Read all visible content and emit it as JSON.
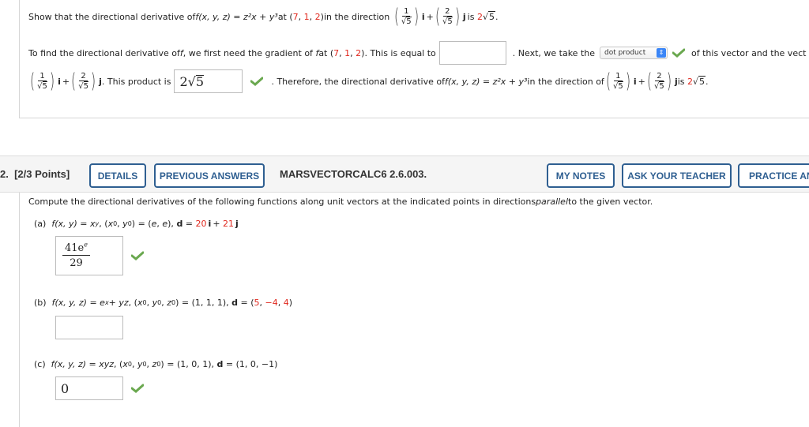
{
  "question1": {
    "statement": {
      "prefix": "Show that the directional derivative of ",
      "function": "f(x, y, z) = z²x + y³",
      "at_text": " at ",
      "point_open": "(",
      "point": [
        "7",
        "1",
        "2"
      ],
      "point_close": ")",
      "direction_text": " in the direction ",
      "direction": {
        "i_num": "1",
        "i_den": "5",
        "j_num": "2",
        "j_den": "5"
      },
      "is_text": " is ",
      "result_coef": "2",
      "result_root": "5"
    },
    "solution": {
      "line1_prefix": "To find the directional derivative of ",
      "f": "f",
      "line1_mid": ", we first need the gradient of ",
      "line1_at": " at ",
      "line1_suffix": ". This is equal to",
      "gradient_input_value": "",
      "next_text": ". Next, we take the",
      "select_value": "dot product",
      "after_select": "of this vector and the vect",
      "line2_product_text": ". This product is",
      "product_answer_coef": "2",
      "product_answer_root": "5",
      "therefore_text": ". Therefore, the directional derivative of ",
      "in_direction_text": " in the direction of ",
      "is_text": " is "
    }
  },
  "question2": {
    "number": "2.",
    "points": "[2/3 Points]",
    "buttons": {
      "details": "DETAILS",
      "previous_answers": "PREVIOUS ANSWERS",
      "my_notes": "MY NOTES",
      "ask_teacher": "ASK YOUR TEACHER",
      "practice": "PRACTICE ANOTHER"
    },
    "code": "MARSVECTORCALC6 2.6.003.",
    "instructions_prefix": "Compute the directional derivatives of the following functions along unit vectors at the indicated points in directions ",
    "instructions_em": "parallel",
    "instructions_suffix": " to the given vector.",
    "parts": [
      {
        "label": "(a)",
        "function": "f(x, y) = x",
        "function_sup": "y",
        "point_text": ", (x",
        "point_vals": "(e, e)",
        "d_label": "d",
        "d_i": "20",
        "d_j": "21",
        "answer_num": "41e",
        "answer_num_sup": "e",
        "answer_den": "29",
        "status": "correct"
      },
      {
        "label": "(b)",
        "function": "f(x, y, z) = e",
        "function_sup": "x",
        "function_rest": " + yz",
        "point_vals": "(1, 1, 1)",
        "d_label": "d",
        "d_vals": [
          "5",
          "−4",
          "4"
        ],
        "answer": "",
        "status": "unanswered"
      },
      {
        "label": "(c)",
        "function": "f(x, y, z) = xyz",
        "point_vals": "(1, 0, 1)",
        "d_label": "d",
        "d_vals": "(1, 0, −1)",
        "answer": "0",
        "status": "correct"
      }
    ]
  },
  "colors": {
    "accent_red": "#e0281e",
    "button_blue": "#2f5f91",
    "check_green": "#6aa84f",
    "select_blue": "#3b86f7"
  }
}
